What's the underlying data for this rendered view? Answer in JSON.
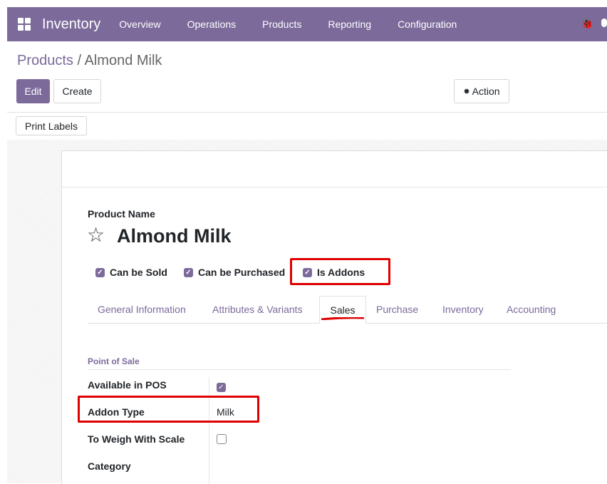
{
  "navbar": {
    "brand": "Inventory",
    "menu": [
      "Overview",
      "Operations",
      "Products",
      "Reporting",
      "Configuration"
    ],
    "accent_color": "#7c6a9b"
  },
  "breadcrumb": {
    "parent": "Products",
    "separator": " / ",
    "current": "Almond Milk"
  },
  "toolbar": {
    "edit_label": "Edit",
    "create_label": "Create",
    "action_label": "Action",
    "print_labels_label": "Print Labels"
  },
  "product": {
    "name_label": "Product Name",
    "name": "Almond Milk",
    "favorite": false,
    "checkboxes": [
      {
        "label": "Can be Sold",
        "checked": true
      },
      {
        "label": "Can be Purchased",
        "checked": true
      },
      {
        "label": "Is Addons",
        "checked": true
      }
    ]
  },
  "tabs": [
    {
      "label": "General Information",
      "active": false
    },
    {
      "label": "Attributes & Variants",
      "active": false
    },
    {
      "label": "Sales",
      "active": true
    },
    {
      "label": "Purchase",
      "active": false
    },
    {
      "label": "Inventory",
      "active": false
    },
    {
      "label": "Accounting",
      "active": false
    }
  ],
  "point_of_sale": {
    "title": "Point of Sale",
    "fields": [
      {
        "label": "Available in POS",
        "type": "checkbox",
        "checked": true
      },
      {
        "label": "Addon Type",
        "type": "text",
        "value": "Milk"
      },
      {
        "label": "To Weigh With Scale",
        "type": "checkbox",
        "checked": false
      },
      {
        "label": "Category",
        "type": "text",
        "value": ""
      }
    ]
  },
  "highlight_color": "#e00000"
}
